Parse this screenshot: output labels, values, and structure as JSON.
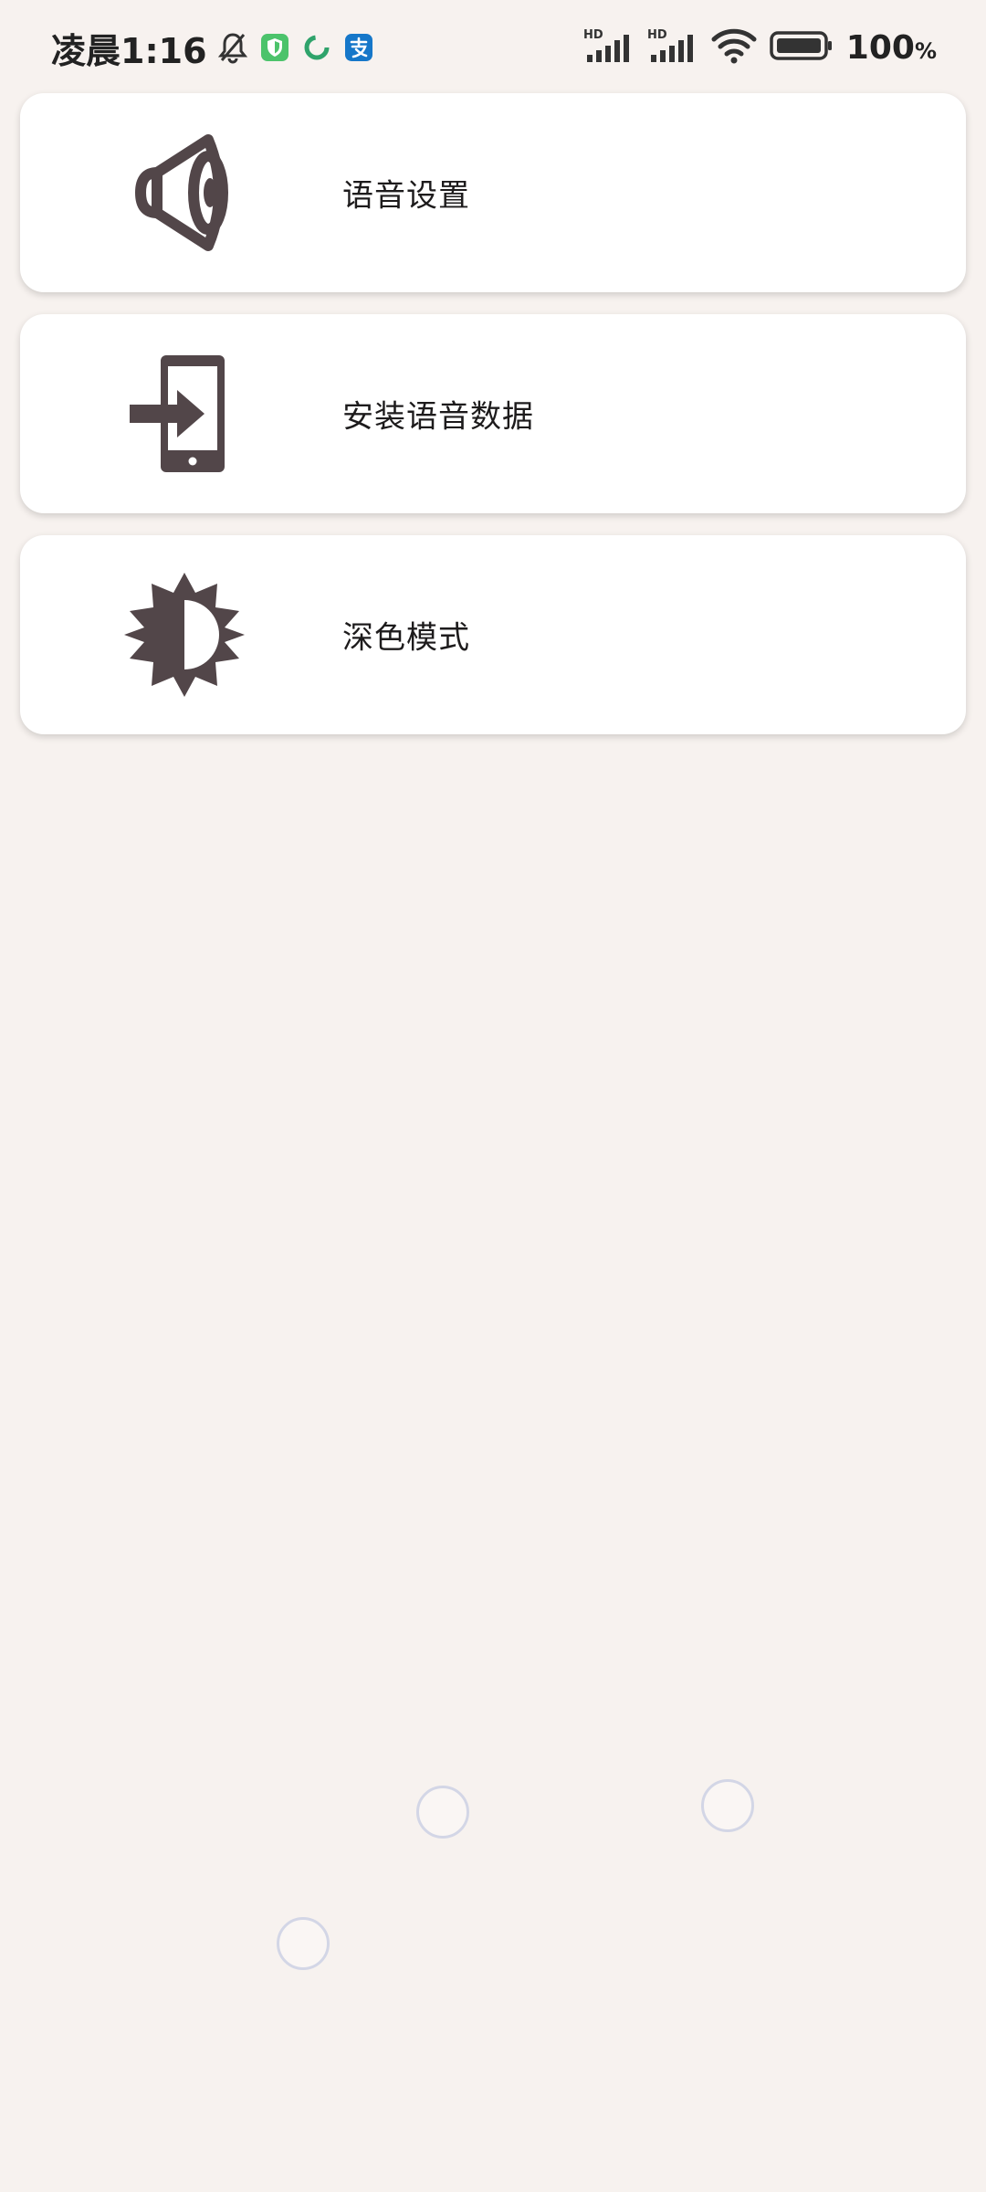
{
  "status_bar": {
    "time": "凌晨1:16",
    "notification_icons": [
      "bell-muted-icon",
      "shield-app-icon",
      "recycle-app-icon",
      "alipay-app-icon"
    ],
    "signal_label_1": "HD",
    "signal_label_2": "HD",
    "battery_percent": "100",
    "battery_unit": "%"
  },
  "menu": {
    "items": [
      {
        "label": "语音设置",
        "icon": "speaker-icon"
      },
      {
        "label": "安装语音数据",
        "icon": "phone-import-icon"
      },
      {
        "label": "深色模式",
        "icon": "contrast-icon"
      }
    ]
  },
  "colors": {
    "background": "#f7f2ef",
    "card": "#ffffff",
    "icon": "#524649",
    "text": "#1d1b1c"
  }
}
